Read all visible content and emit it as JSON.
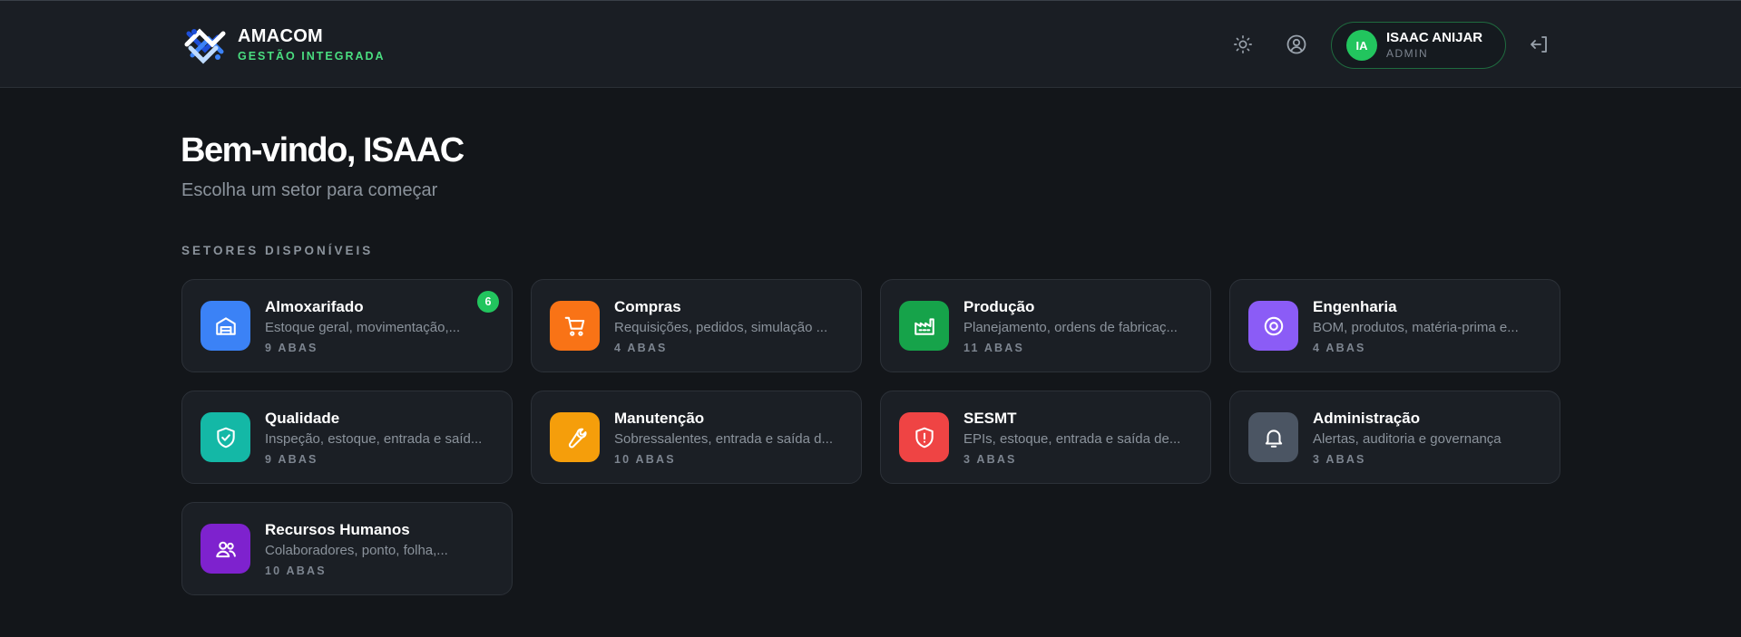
{
  "brand": {
    "name": "AMACOM",
    "subtitle": "GESTÃO INTEGRADA"
  },
  "header": {
    "theme_icon": "sun-icon",
    "profile_icon": "user-circle-icon",
    "logout_icon": "logout-icon",
    "user": {
      "initials": "IA",
      "name": "ISAAC ANIJAR",
      "role": "ADMIN"
    }
  },
  "main": {
    "welcome": "Bem-vindo, ISAAC",
    "subtitle": "Escolha um setor para começar",
    "section_label": "SETORES DISPONÍVEIS",
    "sectors": [
      {
        "title": "Almoxarifado",
        "description": "Estoque geral, movimentação,...",
        "tabs": "9 ABAS",
        "badge": "6",
        "icon": "warehouse-icon",
        "color": "#3b82f6"
      },
      {
        "title": "Compras",
        "description": "Requisições, pedidos, simulação ...",
        "tabs": "4 ABAS",
        "icon": "cart-icon",
        "color": "#f97316"
      },
      {
        "title": "Produção",
        "description": "Planejamento, ordens de fabricaç...",
        "tabs": "11 ABAS",
        "icon": "factory-icon",
        "color": "#16a34a"
      },
      {
        "title": "Engenharia",
        "description": "BOM, produtos, matéria-prima e...",
        "tabs": "4 ABAS",
        "icon": "target-icon",
        "color": "#8b5cf6"
      },
      {
        "title": "Qualidade",
        "description": "Inspeção, estoque, entrada e saíd...",
        "tabs": "9 ABAS",
        "icon": "shield-check-icon",
        "color": "#14b8a6"
      },
      {
        "title": "Manutenção",
        "description": "Sobressalentes, entrada e saída d...",
        "tabs": "10 ABAS",
        "icon": "wrench-icon",
        "color": "#f59e0b"
      },
      {
        "title": "SESMT",
        "description": "EPIs, estoque, entrada e saída de...",
        "tabs": "3 ABAS",
        "icon": "shield-alert-icon",
        "color": "#ef4444"
      },
      {
        "title": "Administração",
        "description": "Alertas, auditoria e governança",
        "tabs": "3 ABAS",
        "icon": "bell-icon",
        "color": "#4b5563"
      },
      {
        "title": "Recursos Humanos",
        "description": "Colaboradores, ponto, folha,...",
        "tabs": "10 ABAS",
        "icon": "users-icon",
        "color": "#7e22ce"
      }
    ]
  }
}
